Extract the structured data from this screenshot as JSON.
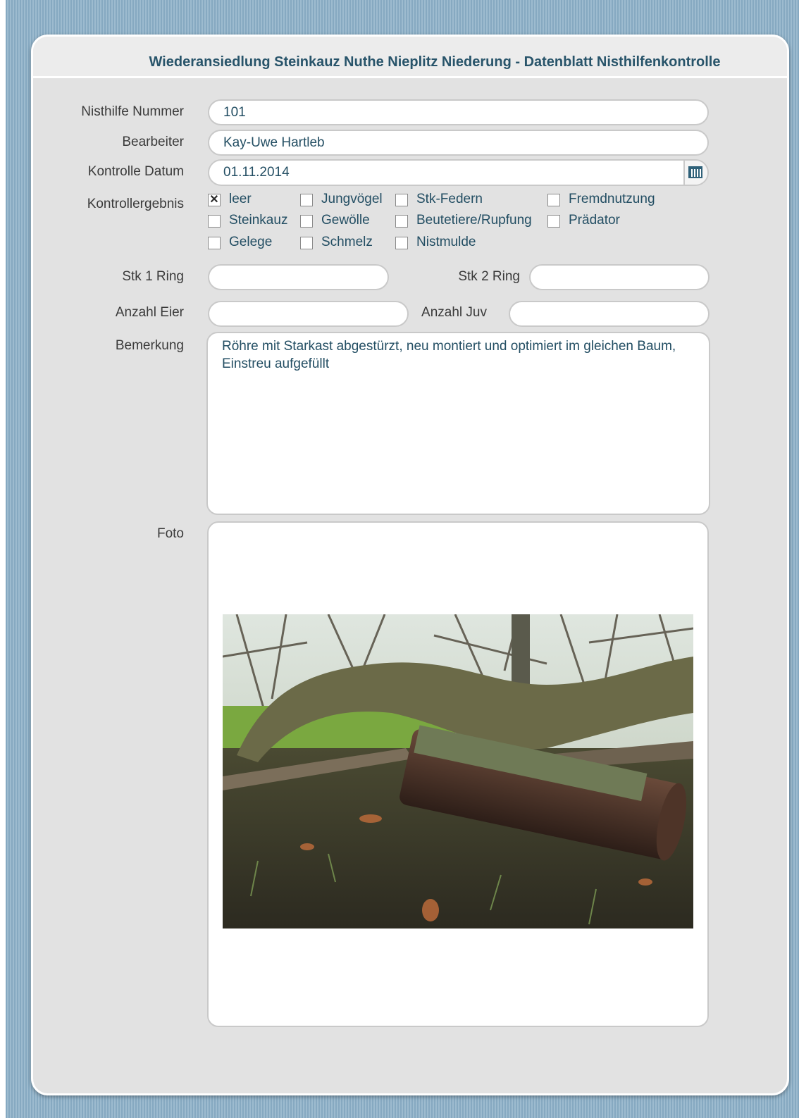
{
  "form": {
    "title": "Wiederansiedlung Steinkauz Nuthe Nieplitz Niederung - Datenblatt Nisthilfenkontrolle"
  },
  "fields": {
    "nisthilfe_nummer": {
      "label": "Nisthilfe Nummer",
      "value": "101"
    },
    "bearbeiter": {
      "label": "Bearbeiter",
      "value": "Kay-Uwe Hartleb"
    },
    "kontrolle_datum": {
      "label": "Kontrolle Datum",
      "value": "01.11.2014",
      "icon": "calendar-icon"
    },
    "kontrollergebnis": {
      "label": "Kontrollergebnis",
      "options": [
        {
          "label": "leer",
          "checked": true
        },
        {
          "label": "Jungvögel",
          "checked": false
        },
        {
          "label": "Stk-Federn",
          "checked": false
        },
        {
          "label": "Fremdnutzung",
          "checked": false
        },
        {
          "label": "Steinkauz",
          "checked": false
        },
        {
          "label": "Gewölle",
          "checked": false
        },
        {
          "label": "Beutetiere/Rupfung",
          "checked": false
        },
        {
          "label": "Prädator",
          "checked": false
        },
        {
          "label": "Gelege",
          "checked": false
        },
        {
          "label": "Schmelz",
          "checked": false
        },
        {
          "label": "Nistmulde",
          "checked": false
        }
      ]
    },
    "stk1_ring": {
      "label": "Stk 1 Ring",
      "value": ""
    },
    "stk2_ring": {
      "label": "Stk 2 Ring",
      "value": ""
    },
    "anzahl_eier": {
      "label": "Anzahl Eier",
      "value": ""
    },
    "anzahl_juv": {
      "label": "Anzahl Juv",
      "value": ""
    },
    "bemerkung": {
      "label": "Bemerkung",
      "value": "Röhre mit Starkast abgestürzt, neu montiert und optimiert im gleichen Baum, Einstreu aufgefüllt"
    },
    "foto": {
      "label": "Foto"
    }
  },
  "colors": {
    "title": "#28546a",
    "value_text": "#234e63",
    "panel": "#e2e2e2",
    "background": "#8fb0c6"
  }
}
